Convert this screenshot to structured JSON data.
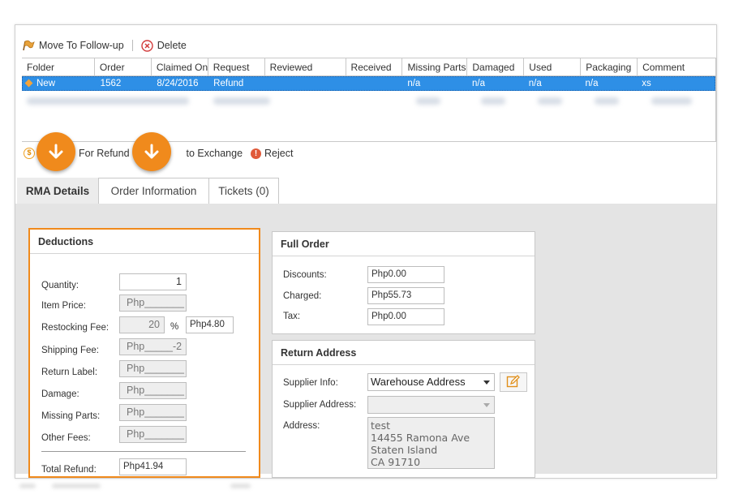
{
  "toolbar": {
    "move_label": "Move To Follow-up",
    "delete_label": "Delete"
  },
  "grid": {
    "columns": [
      "Folder",
      "Order",
      "Claimed On",
      "Request",
      "Reviewed",
      "Received",
      "Missing Parts",
      "Damaged",
      "Used",
      "Packaging",
      "Comment"
    ],
    "selected_row": [
      "New",
      "1562",
      "8/24/2016",
      "Refund",
      "",
      "",
      "n/a",
      "n/a",
      "n/a",
      "n/a",
      "xs"
    ]
  },
  "actions": {
    "refund_label": "For Refund",
    "exchange_label": "to Exchange",
    "reject_label": "Reject"
  },
  "tabs": {
    "rma_details": "RMA Details",
    "order_information": "Order Information",
    "tickets": "Tickets (0)"
  },
  "deductions": {
    "title": "Deductions",
    "quantity_label": "Quantity:",
    "quantity_value": "1",
    "item_price_label": "Item Price:",
    "item_price_value": "Php_______",
    "restocking_label": "Restocking Fee:",
    "restocking_percent": "20",
    "percent_sign": "%",
    "restocking_amount": "Php4.80",
    "shipping_label": "Shipping Fee:",
    "shipping_value": "Php_____-2",
    "return_label_label": "Return Label:",
    "return_label_value": "Php_______",
    "damage_label": "Damage:",
    "damage_value": "Php_______",
    "missing_parts_label": "Missing Parts:",
    "missing_parts_value": "Php_______",
    "other_fees_label": "Other Fees:",
    "other_fees_value": "Php_______",
    "total_label": "Total Refund:",
    "total_value": "Php41.94"
  },
  "full_order": {
    "title": "Full Order",
    "discounts_label": "Discounts:",
    "discounts_value": "Php0.00",
    "charged_label": "Charged:",
    "charged_value": "Php55.73",
    "tax_label": "Tax:",
    "tax_value": "Php0.00"
  },
  "return_address": {
    "title": "Return Address",
    "supplier_info_label": "Supplier Info:",
    "supplier_info_value": "Warehouse Address",
    "supplier_address_label": "Supplier Address:",
    "supplier_address_value": "",
    "address_label": "Address:",
    "address_value": "test\n14455 Ramona Ave\nStaten Island\nCA 91710"
  },
  "colors": {
    "accent": "#f08a1c",
    "selected_row": "#2e8fe6",
    "panel_bg": "#e4e4e4"
  },
  "icons": {
    "move": "flag-icon",
    "delete": "delete-icon",
    "refund": "coin-icon",
    "reject": "reject-icon",
    "callout": "down-arrow-icon",
    "edit": "edit-icon"
  }
}
